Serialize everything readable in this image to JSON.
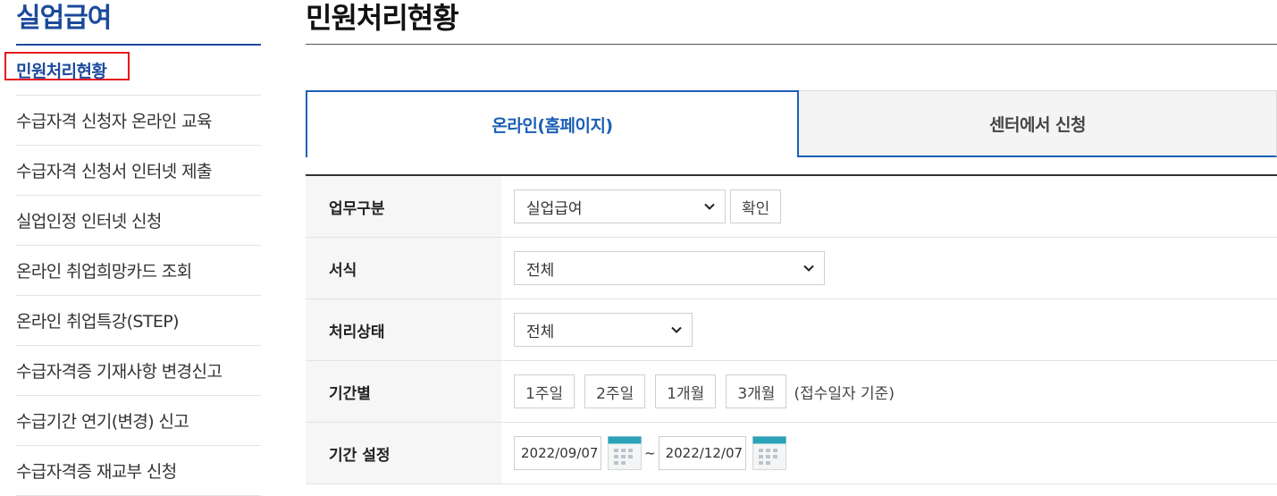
{
  "sidebar": {
    "title": "실업급여",
    "items": [
      {
        "label": "민원처리현황",
        "active": true
      },
      {
        "label": "수급자격 신청자 온라인 교육"
      },
      {
        "label": "수급자격 신청서 인터넷 제출"
      },
      {
        "label": "실업인정 인터넷 신청"
      },
      {
        "label": "온라인 취업희망카드 조회"
      },
      {
        "label": "온라인 취업특강(STEP)"
      },
      {
        "label": "수급자격증 기재사항 변경신고"
      },
      {
        "label": "수급기간 연기(변경) 신고"
      },
      {
        "label": "수급자격증 재교부 신청"
      }
    ]
  },
  "main": {
    "title": "민원처리현황",
    "tabs": [
      {
        "label": "온라인(홈페이지)",
        "active": true
      },
      {
        "label": "센터에서 신청",
        "active": false
      }
    ],
    "form": {
      "business_type": {
        "label": "업무구분",
        "selected": "실업급여",
        "confirm_label": "확인"
      },
      "format": {
        "label": "서식",
        "selected": "전체"
      },
      "status": {
        "label": "처리상태",
        "selected": "전체"
      },
      "period": {
        "label": "기간별",
        "buttons": [
          "1주일",
          "2주일",
          "1개월",
          "3개월"
        ],
        "note": "(접수일자 기준)"
      },
      "date_range": {
        "label": "기간 설정",
        "start": "2022/09/07",
        "separator": "~",
        "end": "2022/12/07"
      }
    }
  },
  "colors": {
    "accent": "#1b5fb6",
    "brand": "#1b4a9c",
    "highlight": "#e8141b",
    "calendar": "#2aa3b8"
  },
  "icons": {
    "select_arrow": "chevron-down-icon",
    "date_picker": "calendar-icon"
  }
}
